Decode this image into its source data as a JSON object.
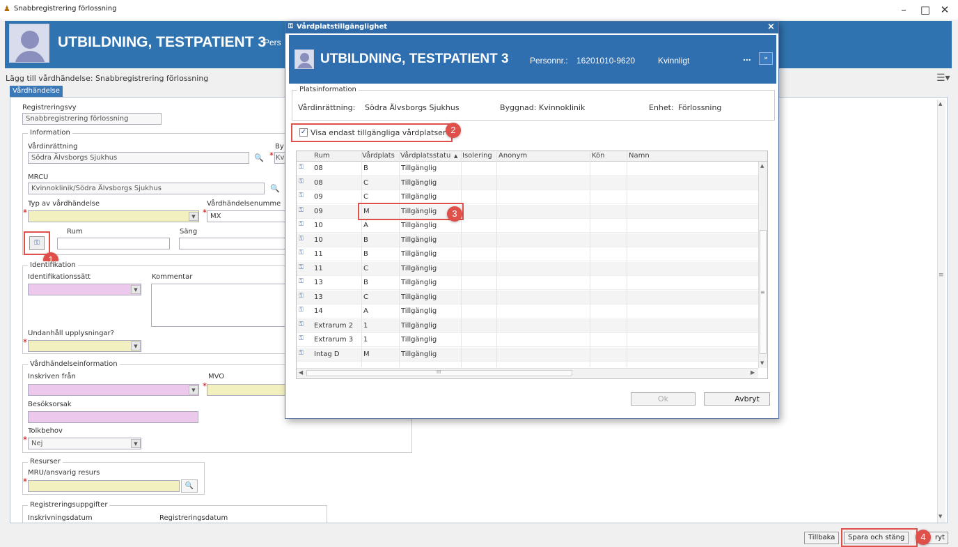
{
  "window": {
    "title": "Snabbregistrering förlossning",
    "minimize": "–",
    "restore": "□",
    "close": "✕"
  },
  "patient": {
    "name": "UTBILDNING, TESTPATIENT 3",
    "person_label_truncated": "Pers"
  },
  "subheader": "Lägg till vårdhändelse: Snabbregistrering förlossning",
  "tab": "Vårdhändelse",
  "form": {
    "registreringsvy_label": "Registreringsvy",
    "registreringsvy_value": "Snabbregistrering förlossning",
    "information_legend": "Information",
    "vardinrattning_label": "Vårdinrättning",
    "vardinrattning_value": "Södra Älvsborgs Sjukhus",
    "byggnad_label_trunc": "By",
    "byggnad_value_trunc": "Kv",
    "mrcu_label": "MRCU",
    "mrcu_value": "Kvinnoklinik/Södra Älvsborgs Sjukhus",
    "typ_label": "Typ av vårdhändelse",
    "vhnummer_label": "Vårdhändelsenumme",
    "vhnummer_value": "MX",
    "rum_label": "Rum",
    "sang_label": "Säng",
    "identifikation_legend": "Identifikation",
    "identsatt_label": "Identifikationssätt",
    "kommentar_label": "Kommentar",
    "undanhall_label": "Undanhåll upplysningar?",
    "vhinfo_legend": "Vårdhändelseinformation",
    "inskriven_label": "Inskriven från",
    "mvo_label": "MVO",
    "besoksorsak_label": "Besöksorsak",
    "tolkbehov_label": "Tolkbehov",
    "tolkbehov_value": "Nej",
    "resurser_legend": "Resurser",
    "mru_label": "MRU/ansvarig resurs",
    "regupp_legend": "Registreringsuppgifter",
    "inskrivningsdatum_label": "Inskrivningsdatum",
    "registreringsdatum_label": "Registreringsdatum"
  },
  "buttons": {
    "tillbaka": "Tillbaka",
    "spara_och_stang": "Spara och stäng",
    "avbryt_trunc": "ryt"
  },
  "dialog": {
    "title": "Vårdplatstillgänglighet",
    "close": "×",
    "patient_name": "UTBILDNING, TESTPATIENT 3",
    "personnr_label": "Personnr.:",
    "personnr_value": "16201010-9620",
    "gender": "Kvinnligt",
    "more": "...",
    "platsinfo_legend": "Platsinformation",
    "vardinrattning_label": "Vårdinrättning:",
    "vardinrattning_value": "Södra Älvsborgs Sjukhus",
    "byggnad_label": "Byggnad:",
    "byggnad_value": "Kvinnoklinik",
    "enhet_label": "Enhet:",
    "enhet_value": "Förlossning",
    "checkbox_label": "Visa endast tillgängliga vårdplatser",
    "columns": [
      "Rum",
      "Vårdplats",
      "Vårdplatsstatu",
      "Isolering",
      "Anonym",
      "Kön",
      "Namn"
    ],
    "rows": [
      {
        "rum": "08",
        "plats": "B",
        "status": "Tillgänglig"
      },
      {
        "rum": "08",
        "plats": "C",
        "status": "Tillgänglig"
      },
      {
        "rum": "09",
        "plats": "C",
        "status": "Tillgänglig"
      },
      {
        "rum": "09",
        "plats": "M",
        "status": "Tillgänglig"
      },
      {
        "rum": "10",
        "plats": "A",
        "status": "Tillgänglig"
      },
      {
        "rum": "10",
        "plats": "B",
        "status": "Tillgänglig"
      },
      {
        "rum": "11",
        "plats": "B",
        "status": "Tillgänglig"
      },
      {
        "rum": "11",
        "plats": "C",
        "status": "Tillgänglig"
      },
      {
        "rum": "13",
        "plats": "B",
        "status": "Tillgänglig"
      },
      {
        "rum": "13",
        "plats": "C",
        "status": "Tillgänglig"
      },
      {
        "rum": "14",
        "plats": "A",
        "status": "Tillgänglig"
      },
      {
        "rum": "Extrarum 2",
        "plats": "1",
        "status": "Tillgänglig"
      },
      {
        "rum": "Extrarum 3",
        "plats": "1",
        "status": "Tillgänglig"
      },
      {
        "rum": "Intag D",
        "plats": "M",
        "status": "Tillgänglig"
      }
    ],
    "ok": "Ok",
    "avbryt": "Avbryt"
  },
  "markers": [
    "1",
    "2",
    "3",
    "4"
  ],
  "colors": {
    "header_blue": "#2f74b0",
    "marker_red": "#e0504a",
    "required_yellow": "#f3f0c0",
    "required_pink": "#ecc8ec"
  }
}
